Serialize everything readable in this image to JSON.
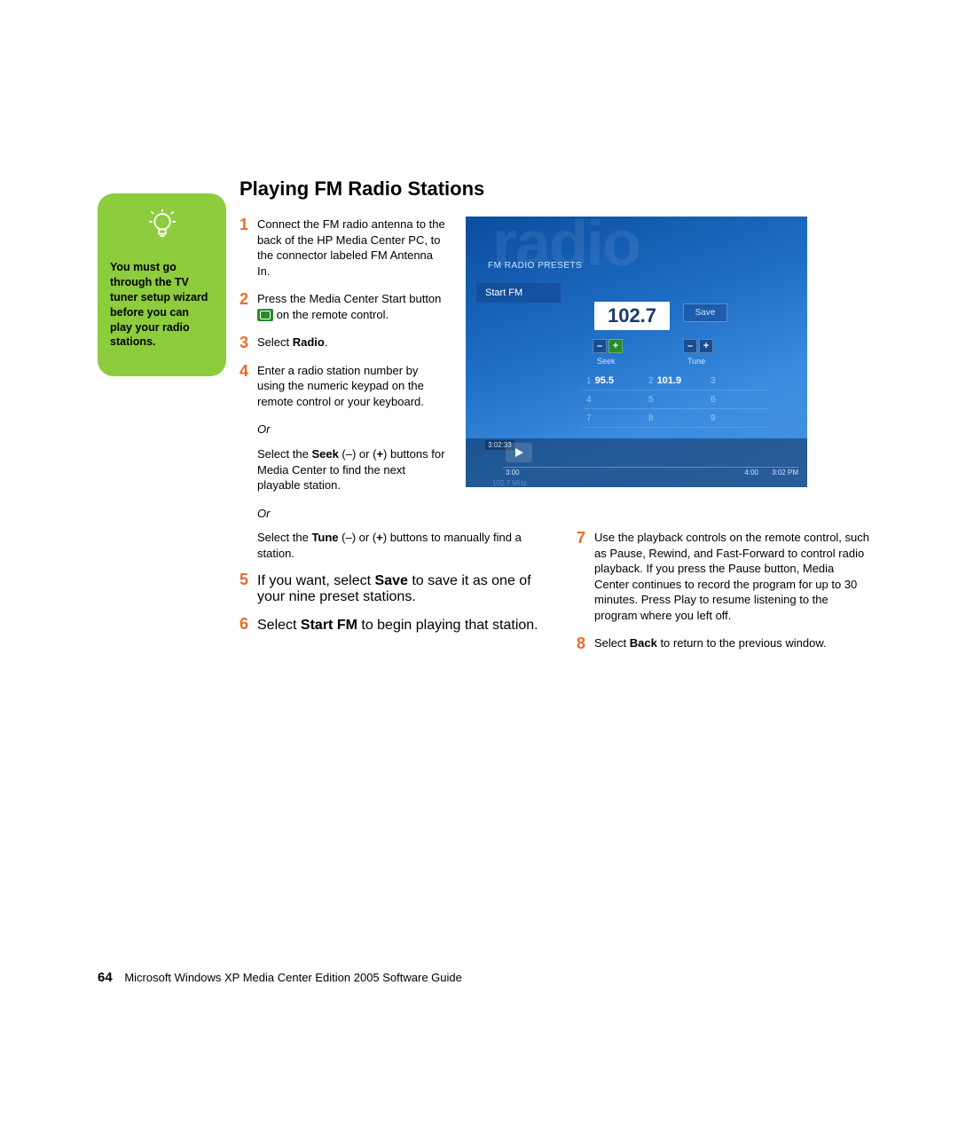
{
  "heading": "Playing FM Radio Stations",
  "tip": {
    "text": "You must go through the TV tuner setup wizard before you can play your radio stations."
  },
  "steps": {
    "s1": {
      "num": "1",
      "text_a": "Connect the FM radio antenna to the back of the HP Media Center PC, to the connector labeled FM Antenna In."
    },
    "s2": {
      "num": "2",
      "text_a": "Press the Media Center Start button ",
      "text_b": " on the remote control."
    },
    "s3": {
      "num": "3",
      "text_a": "Select ",
      "bold_a": "Radio",
      "text_b": "."
    },
    "s4": {
      "num": "4",
      "text_a": "Enter a radio station number by using the numeric keypad on the remote control or your keyboard."
    },
    "or": "Or",
    "s4_alt1_a": "Select the ",
    "s4_alt1_bold": "Seek",
    "s4_alt1_b": " (–) or (",
    "s4_alt1_bold2": "+",
    "s4_alt1_c": ") buttons for Media Center to find the next playable station.",
    "s4_alt2_a": "Select the ",
    "s4_alt2_bold": "Tune",
    "s4_alt2_b": " (–) or (",
    "s4_alt2_bold2": "+",
    "s4_alt2_c": ") buttons to manually find a station.",
    "s5": {
      "num": "5",
      "text_a": "If you want, select ",
      "bold_a": "Save",
      "text_b": " to save it as one of your nine preset stations."
    },
    "s6": {
      "num": "6",
      "text_a": "Select ",
      "bold_a": "Start FM",
      "text_b": " to begin playing that station."
    },
    "s7": {
      "num": "7",
      "text_a": "Use the playback controls on the remote control, such as Pause, Rewind, and Fast-Forward to control radio playback. If you press the Pause button, Media Center continues to record the program for up to 30 minutes. Press Play to resume listening to the program where you left off."
    },
    "s8": {
      "num": "8",
      "text_a": "Select ",
      "bold_a": "Back",
      "text_b": " to return to the previous window."
    }
  },
  "screenshot": {
    "bg_text": "radio",
    "presets_label": "FM RADIO PRESETS",
    "start_fm": "Start FM",
    "frequency": "102.7",
    "save": "Save",
    "seek": "Seek",
    "tune": "Tune",
    "minus": "–",
    "plus": "+",
    "presets": [
      [
        {
          "n": "1",
          "v": "95.5"
        },
        {
          "n": "2",
          "v": "101.9"
        },
        {
          "n": "3",
          "v": ""
        }
      ],
      [
        {
          "n": "4",
          "v": ""
        },
        {
          "n": "5",
          "v": ""
        },
        {
          "n": "6",
          "v": ""
        }
      ],
      [
        {
          "n": "7",
          "v": ""
        },
        {
          "n": "8",
          "v": ""
        },
        {
          "n": "9",
          "v": ""
        }
      ]
    ],
    "time_rec": "3:02:33",
    "time_left": "3:00",
    "time_right1": "4:00",
    "time_right2": "3:02 PM",
    "mhz": "102.7 MHz"
  },
  "footer": {
    "page": "64",
    "text": "Microsoft Windows XP Media Center Edition 2005 Software Guide"
  }
}
